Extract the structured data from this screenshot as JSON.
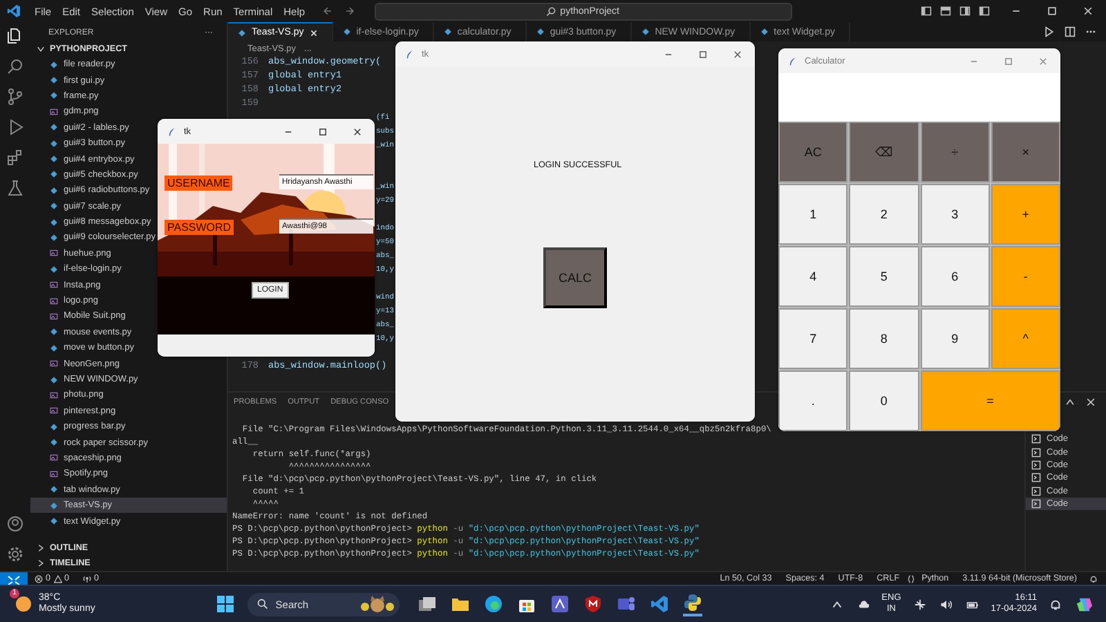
{
  "menu": [
    "File",
    "Edit",
    "Selection",
    "View",
    "Go",
    "Run",
    "Terminal",
    "Help"
  ],
  "command_center": {
    "text": "pythonProject"
  },
  "sidebar": {
    "title": "EXPLORER",
    "more": "···",
    "folder": {
      "name": "PYTHONPROJECT",
      "expanded": true,
      "items": [
        {
          "name": "file reader.py",
          "kind": "py",
          "selected": false
        },
        {
          "name": "first gui.py",
          "kind": "py",
          "selected": false
        },
        {
          "name": "frame.py",
          "kind": "py",
          "selected": false
        },
        {
          "name": "gdm.png",
          "kind": "png",
          "selected": false
        },
        {
          "name": "gui#2 - lables.py",
          "kind": "py",
          "selected": false
        },
        {
          "name": "gui#3 button.py",
          "kind": "py",
          "selected": false
        },
        {
          "name": "gui#4 entrybox.py",
          "kind": "py",
          "selected": false
        },
        {
          "name": "gui#5 checkbox.py",
          "kind": "py",
          "selected": false
        },
        {
          "name": "gui#6 radiobuttons.py",
          "kind": "py",
          "selected": false
        },
        {
          "name": "gui#7 scale.py",
          "kind": "py",
          "selected": false
        },
        {
          "name": "gui#8 messagebox.py",
          "kind": "py",
          "selected": false
        },
        {
          "name": "gui#9 colourselecter.py",
          "kind": "py",
          "selected": false
        },
        {
          "name": "huehue.png",
          "kind": "png",
          "selected": false
        },
        {
          "name": "if-else-login.py",
          "kind": "py",
          "selected": false
        },
        {
          "name": "Insta.png",
          "kind": "png",
          "selected": false
        },
        {
          "name": "logo.png",
          "kind": "png",
          "selected": false
        },
        {
          "name": "Mobile Suit.png",
          "kind": "png",
          "selected": false
        },
        {
          "name": "mouse events.py",
          "kind": "py",
          "selected": false
        },
        {
          "name": "move w button.py",
          "kind": "py",
          "selected": false
        },
        {
          "name": "NeonGen.png",
          "kind": "png",
          "selected": false
        },
        {
          "name": "NEW WINDOW.py",
          "kind": "py",
          "selected": false
        },
        {
          "name": "photu.png",
          "kind": "png",
          "selected": false
        },
        {
          "name": "pinterest.png",
          "kind": "png",
          "selected": false
        },
        {
          "name": "progress bar.py",
          "kind": "py",
          "selected": false
        },
        {
          "name": "rock paper scissor.py",
          "kind": "py",
          "selected": false
        },
        {
          "name": "spaceship.png",
          "kind": "png",
          "selected": false
        },
        {
          "name": "Spotify.png",
          "kind": "png",
          "selected": false
        },
        {
          "name": "tab window.py",
          "kind": "py",
          "selected": false
        },
        {
          "name": "Teast-VS.py",
          "kind": "py",
          "selected": true
        },
        {
          "name": "text Widget.py",
          "kind": "py",
          "selected": false
        }
      ]
    },
    "sections": [
      {
        "name": "OUTLINE",
        "expanded": false
      },
      {
        "name": "TIMELINE",
        "expanded": false
      }
    ]
  },
  "editor": {
    "tabs": [
      {
        "label": "Teast-VS.py",
        "selected": true
      },
      {
        "label": "if-else-login.py",
        "selected": false
      },
      {
        "label": "calculator.py",
        "selected": false
      },
      {
        "label": "gui#3 button.py",
        "selected": false
      },
      {
        "label": "NEW WINDOW.py",
        "selected": false
      },
      {
        "label": "text Widget.py",
        "selected": false
      }
    ],
    "breadcrumb": [
      "Teast-VS.py",
      "..."
    ],
    "lines": [
      {
        "kind": "full",
        "number": "156",
        "text": "abs_window.geometry("
      },
      {
        "kind": "full",
        "number": "157",
        "text": "global entry1"
      },
      {
        "kind": "full",
        "number": "158",
        "text": "global entry2"
      },
      {
        "kind": "full",
        "number": "159"
      },
      {
        "kind": "fragment",
        "text": "(fi"
      },
      {
        "kind": "fragment",
        "text": "subs"
      },
      {
        "kind": "fragment",
        "text": "_win"
      },
      {
        "kind": "hidden"
      },
      {
        "kind": "hidden"
      },
      {
        "kind": "fragment",
        "text": "_win"
      },
      {
        "kind": "fragment",
        "text": "y=29"
      },
      {
        "kind": "hidden"
      },
      {
        "kind": "fragment",
        "text": "indo"
      },
      {
        "kind": "fragment",
        "text": "y=50"
      },
      {
        "kind": "fragment",
        "text": "abs_"
      },
      {
        "kind": "fragment",
        "text": "10,y"
      },
      {
        "kind": "hidden"
      },
      {
        "kind": "fragment",
        "text": "wind"
      },
      {
        "kind": "fragment",
        "text": "y=13"
      },
      {
        "kind": "fragment",
        "text": "abs_"
      },
      {
        "kind": "fragment",
        "text": "10,y"
      },
      {
        "kind": "hidden"
      },
      {
        "kind": "full",
        "number": "178",
        "text": "abs_window.mainloop()"
      }
    ]
  },
  "panel": {
    "tabs": [
      {
        "label": "PROBLEMS",
        "selected": false
      },
      {
        "label": "OUTPUT",
        "selected": false
      },
      {
        "label": "DEBUG CONSO",
        "selected": false
      }
    ],
    "terminal": [
      {
        "kind": "plain",
        "text": "  File \"C:\\Program Files\\WindowsApps\\PythonSoftwareFoundation.Python.3.11_3.11.2544.0_x64__qbz5n2kfra8p0\\"
      },
      {
        "kind": "plain",
        "text": "all__"
      },
      {
        "kind": "plain",
        "text": "    return self.func(*args)"
      },
      {
        "kind": "plain",
        "text": "           ^^^^^^^^^^^^^^^^"
      },
      {
        "kind": "plain",
        "text": "  File \"d:\\pcp\\pcp.python\\pythonProject\\Teast-VS.py\", line 47, in click"
      },
      {
        "kind": "plain",
        "text": "    count += 1"
      },
      {
        "kind": "plain",
        "text": "    ^^^^^"
      },
      {
        "kind": "plain",
        "text": "NameError: name 'count' is not defined"
      },
      {
        "kind": "command",
        "prompt": "PS D:\\pcp\\pcp.python\\pythonProject>",
        "command": "python",
        "flag": "-u",
        "path": "\"d:\\pcp\\pcp.python\\pythonProject\\Teast-VS.py\""
      },
      {
        "kind": "command",
        "prompt": "PS D:\\pcp\\pcp.python\\pythonProject>",
        "command": "python",
        "flag": "-u",
        "path": "\"d:\\pcp\\pcp.python\\pythonProject\\Teast-VS.py\""
      },
      {
        "kind": "command",
        "prompt": "PS D:\\pcp\\pcp.python\\pythonProject>",
        "command": "python",
        "flag": "-u",
        "path": "\"d:\\pcp\\pcp.python\\pythonProject\\Teast-VS.py\""
      }
    ],
    "sessions": [
      {
        "label": "Code",
        "selected": false
      },
      {
        "label": "Code",
        "selected": false
      },
      {
        "label": "Code",
        "selected": false
      },
      {
        "label": "Code",
        "selected": false
      },
      {
        "label": "Code",
        "selected": false
      },
      {
        "label": "Code",
        "selected": true
      }
    ]
  },
  "status_bar": {
    "errors": "0",
    "warnings": "0",
    "ports": "0",
    "right": [
      "Ln 50, Col 33",
      "Spaces: 4",
      "UTF-8",
      "CRLF",
      "Python",
      "3.11.9 64-bit (Microsoft Store)"
    ]
  },
  "login_window": {
    "title": "tk",
    "username_label": "USERNAME",
    "username": "Hridayansh Awasthi",
    "password_label": "PASSWORD",
    "password": "Awasthi@98",
    "button": "LOGIN"
  },
  "success_window": {
    "title": "tk",
    "message": "LOGIN SUCCESSFUL",
    "button": "CALC"
  },
  "calculator": {
    "title": "Calculator",
    "keys": [
      {
        "label": "AC",
        "kind": "func"
      },
      {
        "label": "⌫",
        "kind": "func"
      },
      {
        "label": "÷",
        "kind": "func"
      },
      {
        "label": "×",
        "kind": "func"
      },
      {
        "label": "1",
        "kind": "digit"
      },
      {
        "label": "2",
        "kind": "digit"
      },
      {
        "label": "3",
        "kind": "digit"
      },
      {
        "label": "+",
        "kind": "op"
      },
      {
        "label": "4",
        "kind": "digit"
      },
      {
        "label": "5",
        "kind": "digit"
      },
      {
        "label": "6",
        "kind": "digit"
      },
      {
        "label": "-",
        "kind": "op"
      },
      {
        "label": "7",
        "kind": "digit"
      },
      {
        "label": "8",
        "kind": "digit"
      },
      {
        "label": "9",
        "kind": "digit"
      },
      {
        "label": "^",
        "kind": "op"
      },
      {
        "label": ".",
        "kind": "digit"
      },
      {
        "label": "0",
        "kind": "digit"
      },
      {
        "label": "=",
        "kind": "equals"
      }
    ]
  },
  "taskbar": {
    "temperature": "38°C",
    "weather": "Mostly sunny",
    "badge": "1",
    "search": {
      "placeholder": "Search"
    },
    "language": "ENG",
    "region": "IN",
    "time": "16:11",
    "date": "17-04-2024"
  }
}
